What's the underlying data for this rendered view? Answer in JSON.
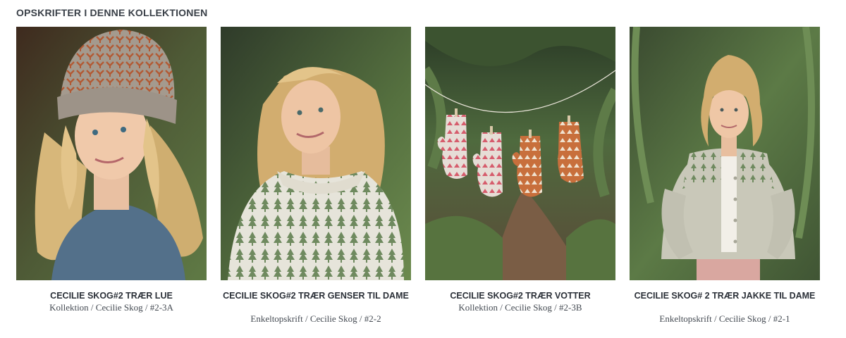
{
  "section": {
    "title": "OPSKRIFTER I DENNE KOLLEKTIONEN"
  },
  "cards": [
    {
      "title": "CECILIE SKOG#2 TRÆR LUE",
      "meta": "Kollektion / Cecilie Skog / #2-3A",
      "image_icon": "woman-knitted-hat-photo"
    },
    {
      "title": "CECILIE SKOG#2 TRÆR GENSER TIL DAME",
      "meta": "Enkeltopskrift / Cecilie Skog / #2-2",
      "image_icon": "woman-knitted-sweater-photo"
    },
    {
      "title": "CECILIE SKOG#2 TRÆR VOTTER",
      "meta": "Kollektion / Cecilie Skog / #2-3B",
      "image_icon": "hanging-mittens-photo"
    },
    {
      "title": "CECILIE SKOG# 2 TRÆR JAKKE TIL DAME",
      "meta": "Enkeltopskrift / Cecilie Skog / #2-1",
      "image_icon": "woman-knitted-cardigan-photo"
    }
  ],
  "colors": {
    "forest_dark": "#2f3b2a",
    "forest_green": "#4f6a3e",
    "sweater_cream": "#e6e4da",
    "tree_green": "#6f8a5f",
    "hat_grey": "#a49a8e",
    "hat_rust": "#b25a34",
    "mitten_rust": "#c86f3c",
    "mitten_grey": "#d8d2cb",
    "mitten_pink": "#d65c6c",
    "shirt_blue": "#53708a",
    "hair_blonde": "#d7b77a"
  }
}
